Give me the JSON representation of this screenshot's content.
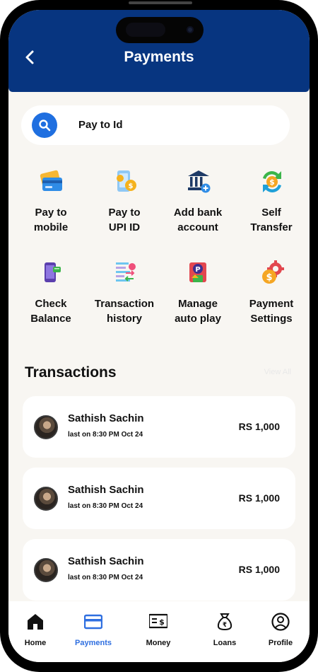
{
  "header": {
    "title": "Payments"
  },
  "search": {
    "label": "Pay to Id"
  },
  "quick_actions": [
    {
      "label": "Pay to\nmobile",
      "icon": "credit-card-icon"
    },
    {
      "label": "Pay to\nUPI ID",
      "icon": "upi-phone-icon"
    },
    {
      "label": "Add bank\naccount",
      "icon": "bank-add-icon"
    },
    {
      "label": "Self\nTransfer",
      "icon": "self-transfer-icon"
    },
    {
      "label": "Check\nBalance",
      "icon": "phone-balance-icon"
    },
    {
      "label": "Transaction\nhistory",
      "icon": "transaction-history-icon"
    },
    {
      "label": "Manage\nauto play",
      "icon": "autopay-icon"
    },
    {
      "label": "Payment\nSettings",
      "icon": "payment-settings-icon"
    }
  ],
  "transactions": {
    "title": "Transactions",
    "view_all": "View All",
    "items": [
      {
        "name": "Sathish Sachin",
        "time": "last on 8:30 PM Oct 24",
        "amount": "RS 1,000"
      },
      {
        "name": "Sathish Sachin",
        "time": "last on 8:30 PM Oct 24",
        "amount": "RS 1,000"
      },
      {
        "name": "Sathish Sachin",
        "time": "last on 8:30 PM Oct 24",
        "amount": "RS 1,000"
      }
    ]
  },
  "bottom_nav": {
    "active_color": "#2f6fe0",
    "items": [
      {
        "label": "Home",
        "icon": "home-icon"
      },
      {
        "label": "Payments",
        "icon": "card-icon",
        "active": true
      },
      {
        "label": "Money",
        "icon": "money-icon"
      },
      {
        "label": "Loans",
        "icon": "loan-bag-icon"
      },
      {
        "label": "Profile",
        "icon": "profile-icon"
      }
    ]
  },
  "colors": {
    "header_bg": "#073580",
    "screen_bg": "#f8f6f2",
    "accent": "#1f6fe0"
  }
}
